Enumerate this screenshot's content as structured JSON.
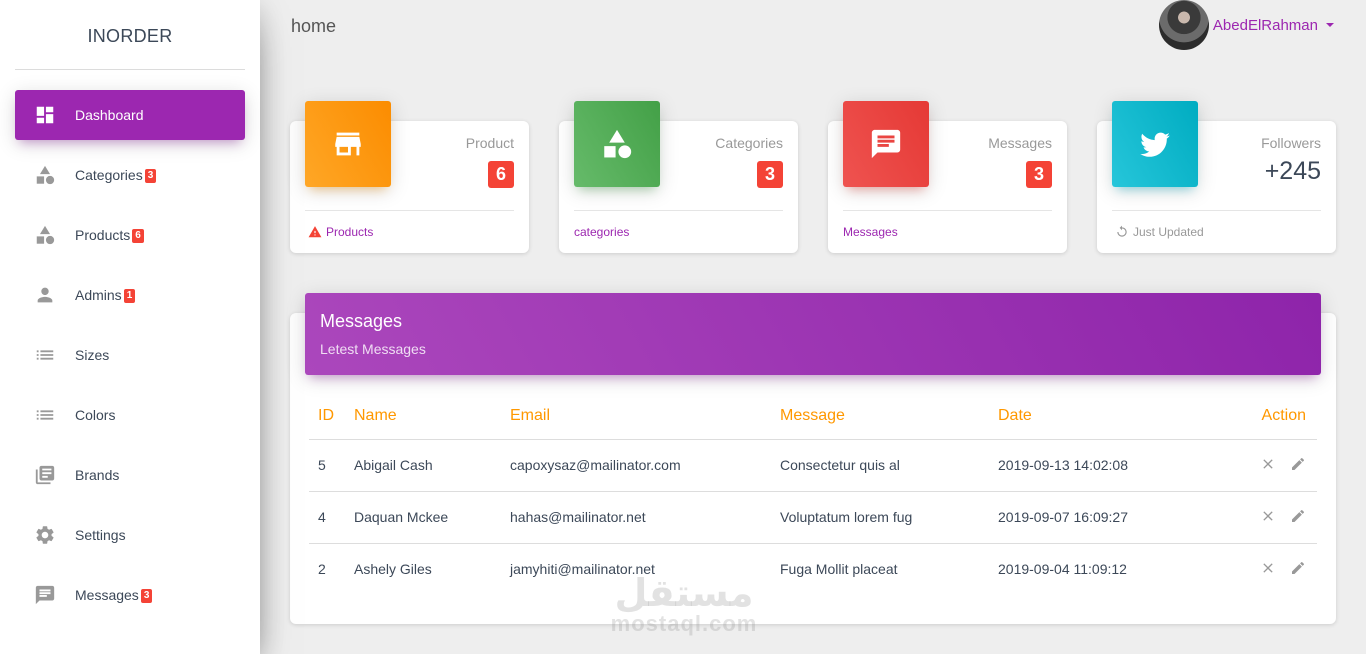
{
  "sidebar": {
    "brand": "INORDER",
    "items": [
      {
        "label": "Dashboard",
        "icon": "dashboard-icon",
        "active": true
      },
      {
        "label": "Categories",
        "icon": "shapes-icon",
        "badge": "3"
      },
      {
        "label": "Products",
        "icon": "shapes-icon",
        "badge": "6"
      },
      {
        "label": "Admins",
        "icon": "person-icon",
        "badge": "1"
      },
      {
        "label": "Sizes",
        "icon": "list-icon"
      },
      {
        "label": "Colors",
        "icon": "list-icon"
      },
      {
        "label": "Brands",
        "icon": "library-icon"
      },
      {
        "label": "Settings",
        "icon": "gear-icon"
      },
      {
        "label": "Messages",
        "icon": "chat-icon",
        "badge": "3"
      }
    ]
  },
  "header": {
    "title": "home",
    "user": {
      "name": "AbedElRahman"
    }
  },
  "stats": [
    {
      "label": "Product",
      "value": "6",
      "footer": "Products",
      "color": "#fb8c00",
      "icon": "store-icon",
      "footer_icon": "warning-icon"
    },
    {
      "label": "Categories",
      "value": "3",
      "footer": "categories",
      "color": "#43a047",
      "icon": "shapes-icon"
    },
    {
      "label": "Messages",
      "value": "3",
      "footer": "Messages",
      "color": "#e53935",
      "icon": "chat-icon"
    },
    {
      "label": "Followers",
      "value": "+245",
      "footer": "Just Updated",
      "color": "#00acc1",
      "icon": "twitter-icon",
      "footer_icon": "refresh-icon"
    }
  ],
  "messages": {
    "title": "Messages",
    "subtitle": "Letest Messages",
    "columns": [
      "ID",
      "Name",
      "Email",
      "Message",
      "Date",
      "Action"
    ],
    "rows": [
      {
        "id": "5",
        "name": "Abigail Cash",
        "email": "capoxysaz@mailinator.com",
        "message": "Consectetur quis al",
        "date": "2019-09-13 14:02:08"
      },
      {
        "id": "4",
        "name": "Daquan Mckee",
        "email": "hahas@mailinator.net",
        "message": "Voluptatum lorem fug",
        "date": "2019-09-07 16:09:27"
      },
      {
        "id": "2",
        "name": "Ashely Giles",
        "email": "jamyhiti@mailinator.net",
        "message": "Fuga Mollit placeat",
        "date": "2019-09-04 11:09:12"
      }
    ]
  },
  "watermark": {
    "arabic": "مستقل",
    "latin": "mostaql.com"
  },
  "colors": {
    "accent": "#9c27b0",
    "badge": "#f44336",
    "table_header": "#ff9800"
  }
}
